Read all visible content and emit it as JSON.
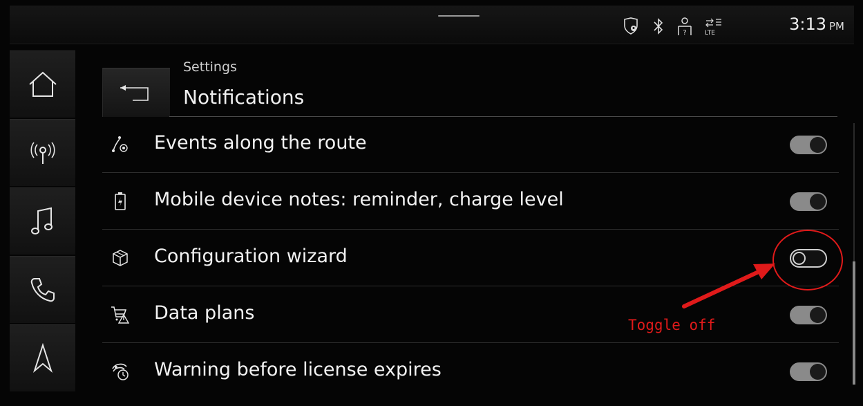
{
  "status_bar": {
    "time": "3:13",
    "ampm": "PM",
    "icons": [
      "location-shield-icon",
      "bluetooth-icon",
      "user-unknown-icon",
      "lte-signal-icon"
    ],
    "lte_label": "LTE"
  },
  "nav": {
    "items": [
      {
        "name": "home-icon"
      },
      {
        "name": "radio-icon"
      },
      {
        "name": "music-icon"
      },
      {
        "name": "phone-icon"
      },
      {
        "name": "navigation-icon"
      }
    ]
  },
  "header": {
    "breadcrumb": "Settings",
    "title": "Notifications",
    "back_icon": "back-arrow-icon"
  },
  "notifications": [
    {
      "label": "Events along the route",
      "icon": "route-events-icon",
      "enabled": true
    },
    {
      "label": "Mobile device notes: reminder, charge level",
      "icon": "battery-charge-icon",
      "enabled": true
    },
    {
      "label": "Configuration wizard",
      "icon": "cube-icon",
      "enabled": false
    },
    {
      "label": "Data plans",
      "icon": "cart-warning-icon",
      "enabled": true
    },
    {
      "label": "Warning before license expires",
      "icon": "license-clock-icon",
      "enabled": true
    }
  ],
  "annotation": {
    "text": "Toggle off",
    "color": "#e01a1a"
  },
  "colors": {
    "toggle_on": "#8a8a8a",
    "background": "#050505"
  }
}
